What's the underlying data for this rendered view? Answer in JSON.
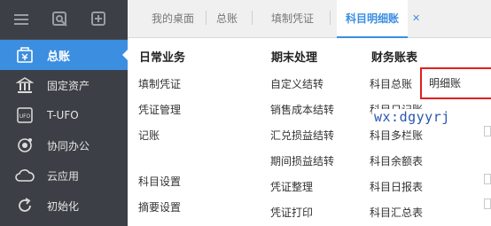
{
  "sidebar": {
    "top_icons": [
      "menu-icon",
      "search-icon",
      "add-icon"
    ],
    "items": [
      {
        "label": "总账",
        "icon": "ledger-icon",
        "active": true
      },
      {
        "label": "固定资产",
        "icon": "bank-icon",
        "active": false
      },
      {
        "label": "T-UFO",
        "icon": "ufo-icon",
        "active": false
      },
      {
        "label": "协同办公",
        "icon": "collab-icon",
        "active": false
      },
      {
        "label": "云应用",
        "icon": "cloud-icon",
        "active": false
      },
      {
        "label": "初始化",
        "icon": "refresh-icon",
        "active": false
      }
    ]
  },
  "tabs": [
    {
      "label": "我的桌面",
      "active": false
    },
    {
      "label": "总账",
      "active": false
    },
    {
      "label": "填制凭证",
      "active": false
    },
    {
      "label": "科目明细账",
      "active": true
    }
  ],
  "tab_close": "✕",
  "columns": {
    "daily": {
      "header": "日常业务",
      "items": [
        "填制凭证",
        "凭证管理",
        "记账",
        "科目设置",
        "摘要设置"
      ]
    },
    "period_end": {
      "header": "期末处理",
      "items": [
        "自定义结转",
        "销售成本结转",
        "汇兑损益结转",
        "期间损益结转",
        "凭证整理",
        "凭证打印"
      ]
    },
    "ledgers": {
      "header": "财务账表",
      "items": [
        "科目总账",
        "明细账",
        "科目日记账",
        "科目多栏账",
        "科目余额表",
        "科目日报表",
        "科目汇总表"
      ]
    }
  },
  "watermark": "wx:dgyyrj",
  "colors": {
    "sidebar_bg": "#3c3f45",
    "accent": "#3b8ee0",
    "highlight_border": "#e02020"
  }
}
